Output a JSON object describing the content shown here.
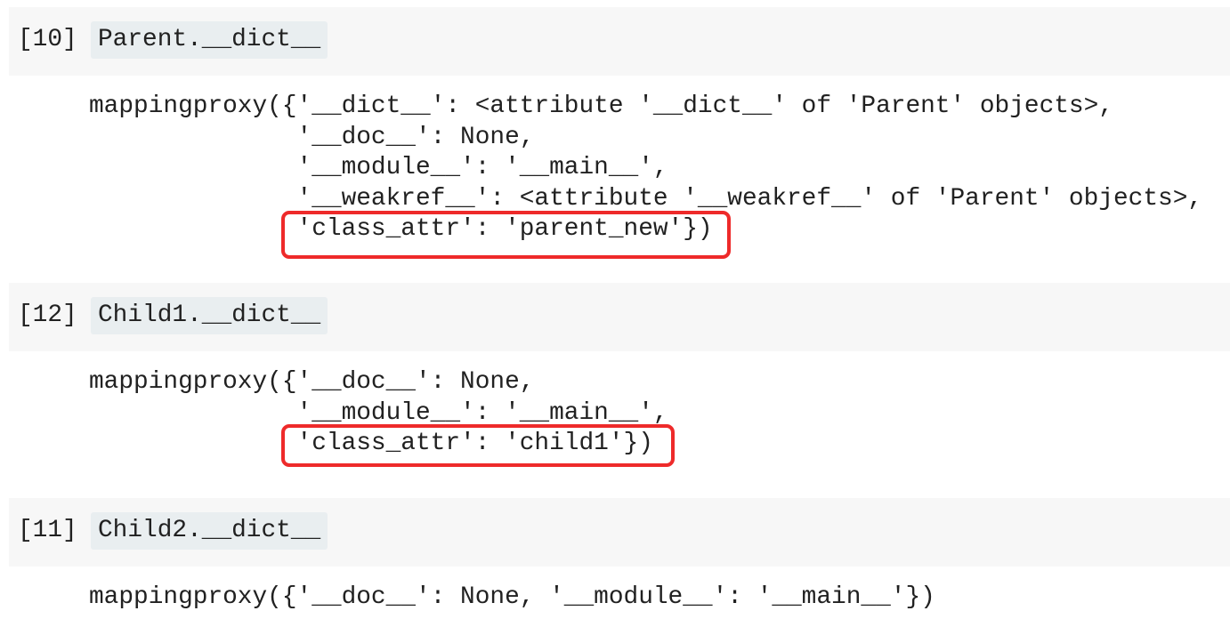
{
  "cells": [
    {
      "prompt": "[10]",
      "code": "Parent.__dict__",
      "output": [
        "mappingproxy({'__dict__': <attribute '__dict__' of 'Parent' objects>,",
        "              '__doc__': None,",
        "              '__module__': '__main__',",
        "              '__weakref__': <attribute '__weakref__' of 'Parent' objects>,",
        "              'class_attr': 'parent_new'})"
      ],
      "highlighted_line": 4
    },
    {
      "prompt": "[12]",
      "code": "Child1.__dict__",
      "output": [
        "mappingproxy({'__doc__': None,",
        "              '__module__': '__main__',",
        "              'class_attr': 'child1'})"
      ],
      "highlighted_line": 2
    },
    {
      "prompt": "[11]",
      "code": "Child2.__dict__",
      "output": [
        "mappingproxy({'__doc__': None, '__module__': '__main__'})"
      ],
      "highlighted_line": null
    }
  ],
  "colors": {
    "highlight_border": "#ee2a2a",
    "cell_bg": "#f7f7f7",
    "code_bg": "#e9eef0"
  }
}
